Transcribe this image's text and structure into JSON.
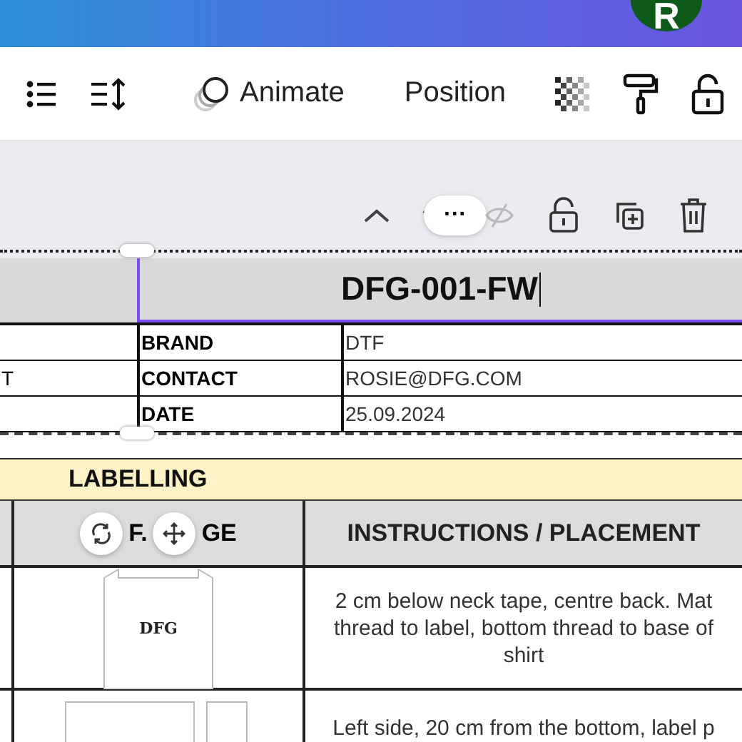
{
  "header": {
    "avatar": "R"
  },
  "toolbar": {
    "animate": "Animate",
    "position": "Position"
  },
  "float_menu": {
    "more": "···"
  },
  "sheet": {
    "title": "DFG-001-FW",
    "info_rows": [
      {
        "left": "",
        "label": "BRAND",
        "value": "DTF"
      },
      {
        "left": "T",
        "label": "CONTACT",
        "value": "ROSIE@DFG.COM"
      },
      {
        "left": "",
        "label": "DATE",
        "value": "25.09.2024"
      }
    ],
    "section": "LABELLING",
    "columns": [
      "F.",
      "GE",
      "INSTRUCTIONS / PLACEMENT"
    ],
    "rows": [
      {
        "kind": "neck-label",
        "logo": "DFG",
        "text": "2 cm below neck tape, centre back. Mat\nthread to label, bottom thread to base of\nshirt"
      },
      {
        "kind": "side-label",
        "text": "Left side, 20 cm from the bottom, label p"
      }
    ]
  }
}
